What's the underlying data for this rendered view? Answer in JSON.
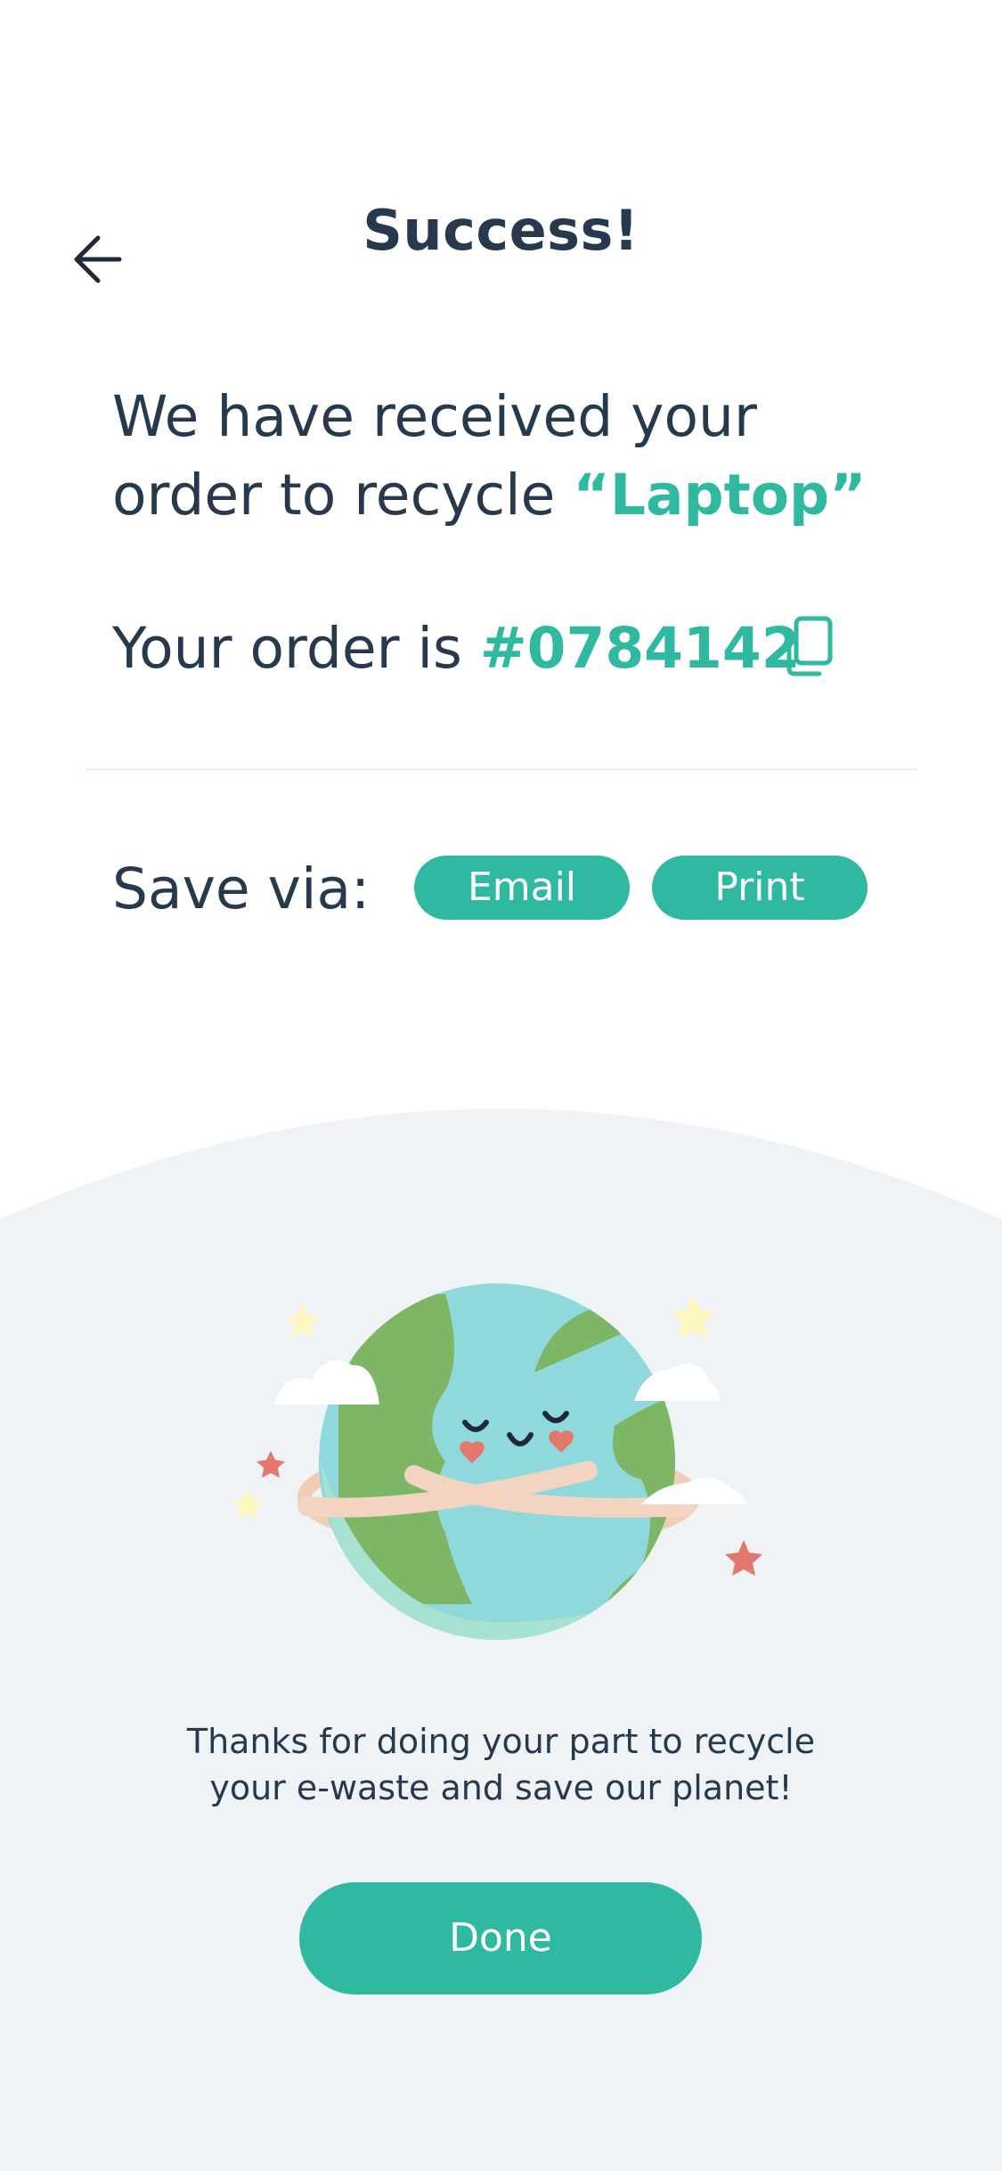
{
  "header": {
    "title": "Success!"
  },
  "order": {
    "msg_line1": "We have received your",
    "msg_line2_prefix": "order to recycle ",
    "item_name": "“Laptop”",
    "number_prefix": "Your order is ",
    "number": "#0784142"
  },
  "save": {
    "label": "Save via:",
    "email_label": "Email",
    "print_label": "Print"
  },
  "footer": {
    "thanks_line1": "Thanks for doing your part to recycle",
    "thanks_line2": "your e-waste and save our planet!",
    "done_label": "Done"
  },
  "colors": {
    "accent": "#2fb9a1",
    "text": "#26394d",
    "bottom_bg": "#f0f3f6"
  },
  "icons": {
    "back": "arrow-left-icon",
    "copy": "copy-icon",
    "illustration": "hugging-earth-illustration"
  }
}
